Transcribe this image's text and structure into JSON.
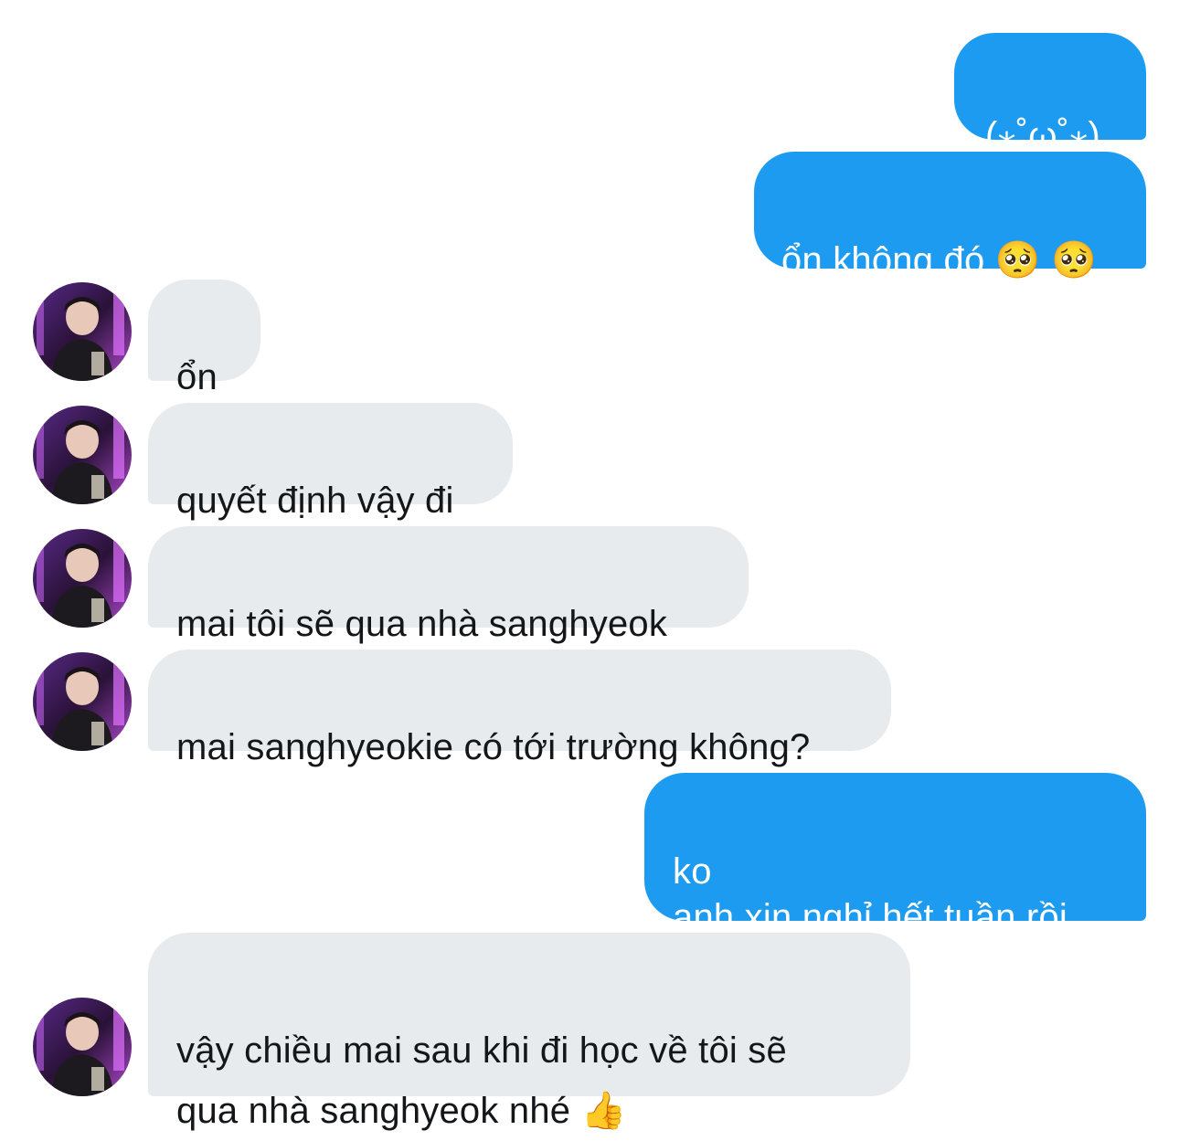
{
  "conversation": {
    "messages": [
      {
        "direction": "sent",
        "text": "(⁎˚̥ω˚̥⁎)"
      },
      {
        "direction": "sent",
        "text": "ổn không đó 🥺 🥺"
      },
      {
        "direction": "received",
        "text": "ổn"
      },
      {
        "direction": "received",
        "text": "quyết định vậy đi"
      },
      {
        "direction": "received",
        "text": "mai tôi sẽ qua nhà sanghyeok"
      },
      {
        "direction": "received",
        "text": "mai sanghyeokie có tới trường không?"
      },
      {
        "direction": "sent",
        "text": "ko\nanh xin nghỉ hết tuần rồi"
      },
      {
        "direction": "received",
        "text": "vậy chiều mai sau khi đi học về tôi sẽ\nqua nhà sanghyeok nhé 👍"
      }
    ]
  },
  "colors": {
    "sent_bubble": "#1d9bf0",
    "received_bubble": "#e8ebee",
    "sent_text": "#ffffff",
    "received_text": "#14171a"
  }
}
